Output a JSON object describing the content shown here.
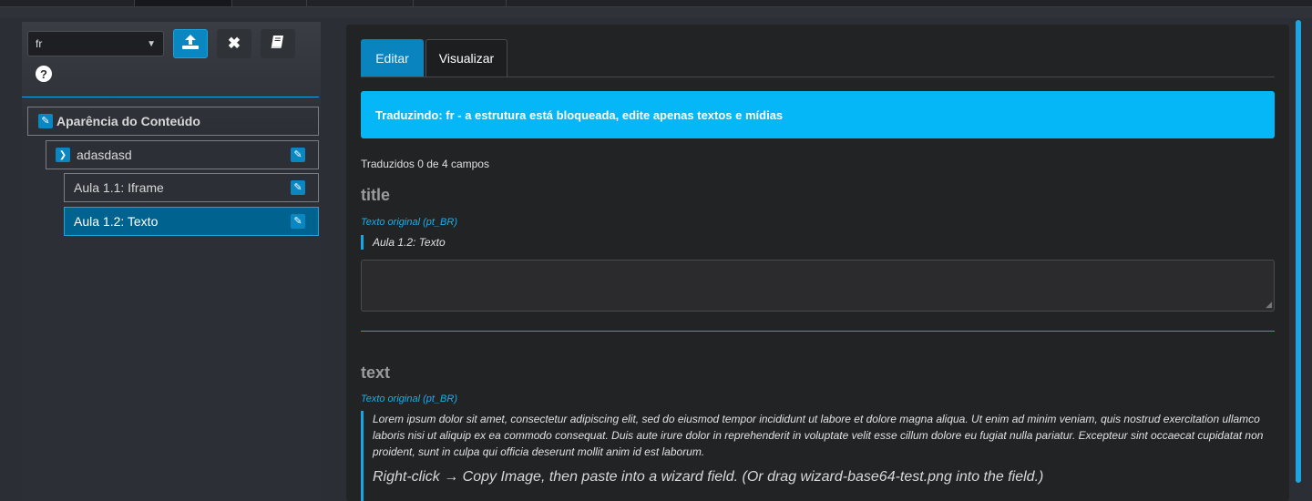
{
  "toolbar": {
    "language_selected": "fr",
    "upload_icon": "upload-icon",
    "close_icon": "close-icon",
    "book_icon": "book-icon",
    "help_icon": "help-icon",
    "help_glyph": "?"
  },
  "tree": {
    "root": {
      "label": "Aparência do Conteúdo"
    },
    "module": {
      "label": "adasdasd"
    },
    "lessons": [
      {
        "label": "Aula 1.1: Iframe"
      },
      {
        "label": "Aula 1.2: Texto",
        "selected": true
      }
    ]
  },
  "main": {
    "tabs": [
      {
        "label": "Editar",
        "active": true
      },
      {
        "label": "Visualizar",
        "active": false
      }
    ],
    "alert": "Traduzindo: fr - a estrutura está bloqueada, edite apenas textos e mídias",
    "progress": "Traduzidos 0 de 4 campos",
    "fields": [
      {
        "name": "title",
        "original_label": "Texto original (pt_BR)",
        "original_text": "Aula 1.2: Texto",
        "value": ""
      },
      {
        "name": "text",
        "original_label": "Texto original (pt_BR)",
        "original_text": "Lorem ipsum dolor sit amet, consectetur adipiscing elit, sed do eiusmod tempor incididunt ut labore et dolore magna aliqua. Ut enim ad minim veniam, quis nostrud exercitation ullamco laboris nisi ut aliquip ex ea commodo consequat. Duis aute irure dolor in reprehenderit in voluptate velit esse cillum dolore eu fugiat nulla pariatur. Excepteur sint occaecat cupidatat non proident, sunt in culpa qui officia deserunt mollit anim id est laborum.",
        "hint": "Right-click → Copy Image, then paste into a wizard field. (Or drag wizard-base64-test.png into the field.)"
      }
    ]
  },
  "colors": {
    "accent": "#0a86c1",
    "alert_bg": "#06b7f8",
    "link_blue": "#17b0ec",
    "panel_bg": "#222325"
  }
}
